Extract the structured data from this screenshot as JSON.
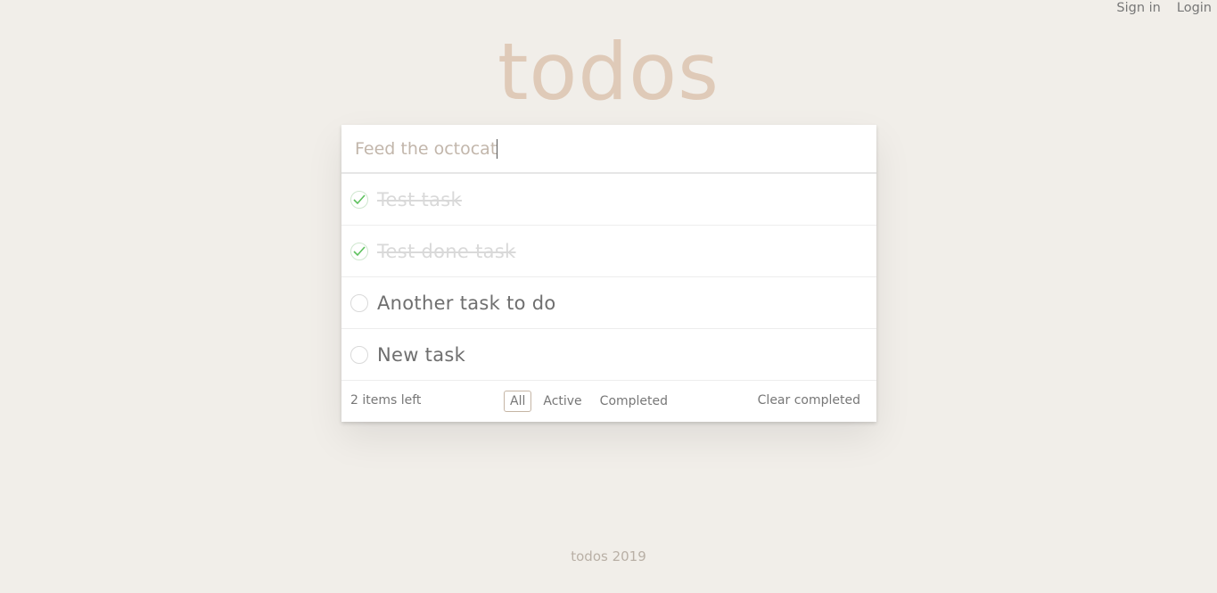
{
  "nav": {
    "signin": "Sign in",
    "login": "Login"
  },
  "header": {
    "title": "todos"
  },
  "new_todo": {
    "value": "Feed the octocat"
  },
  "todos": [
    {
      "label": "Test task",
      "completed": true
    },
    {
      "label": "Test done task",
      "completed": true
    },
    {
      "label": "Another task to do",
      "completed": false
    },
    {
      "label": "New task",
      "completed": false
    }
  ],
  "footer": {
    "count": "2 items left",
    "filters": [
      "All",
      "Active",
      "Completed"
    ],
    "selected_filter": "All",
    "clear": "Clear completed"
  },
  "credit": "todos 2019",
  "colors": {
    "background": "#f1eee9",
    "title": "#dfcab8",
    "check": "#5dc15d"
  }
}
